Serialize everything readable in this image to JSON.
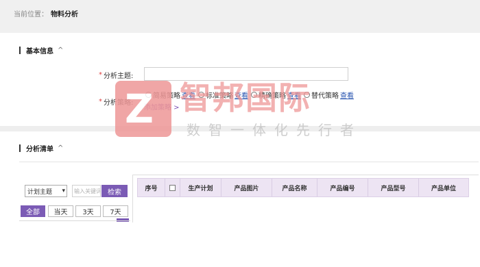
{
  "breadcrumb": {
    "label": "当前位置：",
    "current": "物料分析"
  },
  "basic_info": {
    "title": "基本信息",
    "chevron": "^",
    "subject_label": "分析主题:",
    "subject_value": "",
    "strategy_label": "分析策略:",
    "strategies": [
      {
        "label": "简易策略",
        "view": "查看"
      },
      {
        "label": "标准策略",
        "view": "查看"
      },
      {
        "label": "精确策略",
        "view": "查看"
      },
      {
        "label": "替代策略",
        "view": "查看"
      }
    ],
    "add_strategy": "添加策略 >"
  },
  "analysis_list": {
    "title": "分析清单",
    "chevron": "^",
    "filter_select": "计划主题",
    "keyword_placeholder": "输入关键词",
    "search_button": "检索",
    "ranges": [
      "全部",
      "当天",
      "3天",
      "7天"
    ],
    "active_range": "全部",
    "columns": [
      "序号",
      "",
      "生产计划",
      "产品图片",
      "产品名称",
      "产品编号",
      "产品型号",
      "产品单位"
    ]
  },
  "watermark": {
    "logo_letter": "Z",
    "name": "智邦国际",
    "slogan": "数智一体化先行者"
  },
  "colors": {
    "accent": "#7b5bb5",
    "required": "#e04040",
    "watermark": "#ee9797"
  }
}
